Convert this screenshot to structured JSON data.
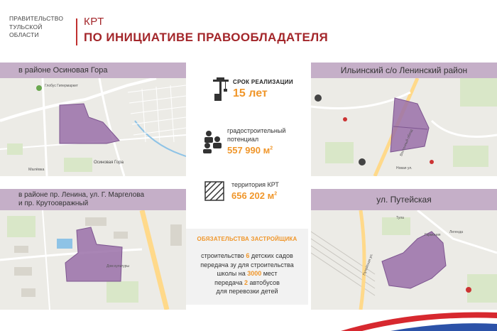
{
  "header": {
    "org_lines": [
      "ПРАВИТЕЛЬСТВО",
      "ТУЛЬСКОЙ",
      "ОБЛАСТИ"
    ],
    "title_line1": "КРТ",
    "title_line2": "ПО ИНИЦИАТИВЕ ПРАВООБЛАДАТЕЛЯ"
  },
  "areas": {
    "top_left": "в районе Осиновая Гора",
    "top_right": "Ильинский с/о Ленинский район",
    "bottom_left_line1": "в районе пр. Ленина, ул. Г. Маргелова",
    "bottom_left_line2": "и пр. Крутоовражный",
    "bottom_right": "ул. Путейская"
  },
  "map_labels": {
    "osinovaya": "Осиновая Гора",
    "maleevka": "Малёвка",
    "globus": "Глобус Гипермаркет",
    "kollektivnaya": "Коллективная ул.",
    "vostochny": "Восточный обход",
    "novaya": "Новая ул.",
    "dom_kultury": "Дом культуры",
    "garmoniya": "Гармония",
    "putejskaya": "Путейская ул.",
    "legenda": "Легенда",
    "tula": "Тула"
  },
  "stats": {
    "term_label": "СРОК РЕАЛИЗАЦИИ",
    "term_value": "15 лет",
    "potential_label_line1": "градостроительный",
    "potential_label_line2": "потенциал",
    "potential_value": "557 990 м",
    "potential_unit_sup": "2",
    "territory_label": "территория КРТ",
    "territory_value": "656 202 м",
    "territory_unit_sup": "2"
  },
  "obligations": {
    "title": "ОБЯЗАТЕЛЬСТВА ЗАСТРОЙЩИКА",
    "l1_a": "строительство ",
    "l1_num": "6",
    "l1_b": " детских садов",
    "l2": "передача зу для строительства",
    "l3_a": "школы на ",
    "l3_num": "3000",
    "l3_b": " мест",
    "l4_a": "передача ",
    "l4_num": "2",
    "l4_b": " автобусов",
    "l5": "для перевозки детей"
  },
  "colors": {
    "accent_red": "#a3262a",
    "band_purple": "#c5afc8",
    "zone_purple": "#9a70a8",
    "orange": "#f0962a",
    "flag_blue": "#2c52a8",
    "flag_red": "#d7282f"
  }
}
